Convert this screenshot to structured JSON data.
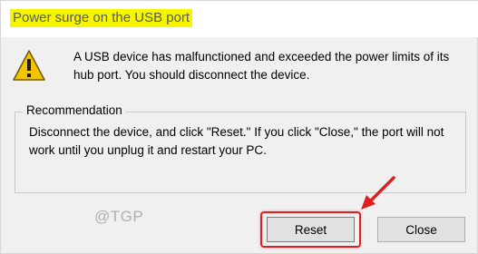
{
  "dialog": {
    "title": "Power surge on the USB port",
    "message": "A USB device has malfunctioned and exceeded the power limits of its hub port. You should disconnect the device.",
    "recommendation_label": "Recommendation",
    "recommendation_text": "Disconnect the device, and click \"Reset.\" If you click \"Close,\" the port will not work until you unplug it and restart your PC.",
    "watermark": "@TGP",
    "buttons": {
      "reset": "Reset",
      "close": "Close"
    }
  },
  "colors": {
    "title_highlight": "#f6f600",
    "warning_yellow": "#f5c400",
    "annotation_red": "#e02020"
  },
  "icons": {
    "warning": "warning-triangle-icon",
    "annotation": "red-arrow-icon"
  }
}
